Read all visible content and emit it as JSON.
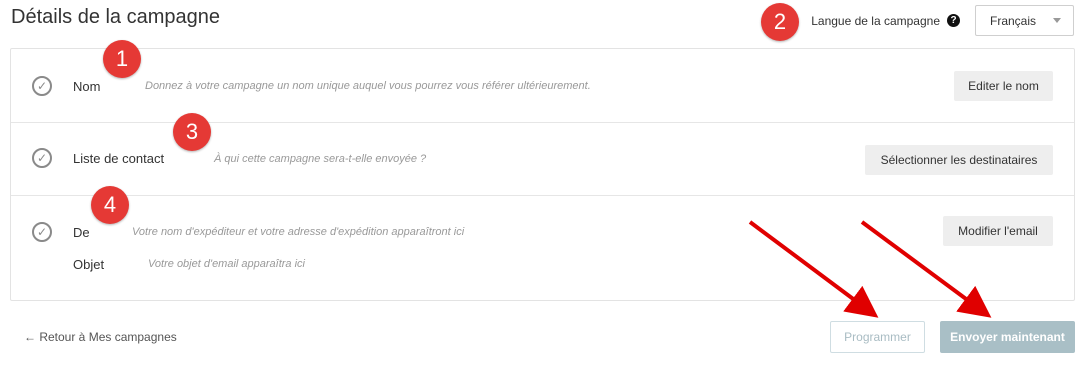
{
  "header": {
    "title": "Détails de la campagne",
    "language_label": "Langue de la campagne",
    "help_glyph": "?",
    "language_value": "Français"
  },
  "rows": [
    {
      "label": "Nom",
      "hint": "Donnez à votre campagne un nom unique auquel vous pourrez vous référer ultérieurement.",
      "button": "Editer le nom"
    },
    {
      "label": "Liste de contact",
      "hint": "À qui cette campagne sera-t-elle envoyée ?",
      "button": "Sélectionner les destinataires"
    },
    {
      "label": "De",
      "hint": "Votre nom d'expéditeur et votre adresse d'expédition apparaîtront ici",
      "sub_label": "Objet",
      "sub_hint": "Votre objet d'email apparaîtra ici",
      "button": "Modifier l'email"
    }
  ],
  "check_glyph": "✓",
  "footer": {
    "back": "← Retour à Mes campagnes",
    "schedule": "Programmer",
    "send_now": "Envoyer maintenant"
  },
  "annotations": {
    "badge_color": "#e53935",
    "arrow_color": "#e00000",
    "badges": [
      "1",
      "2",
      "3",
      "4"
    ]
  }
}
